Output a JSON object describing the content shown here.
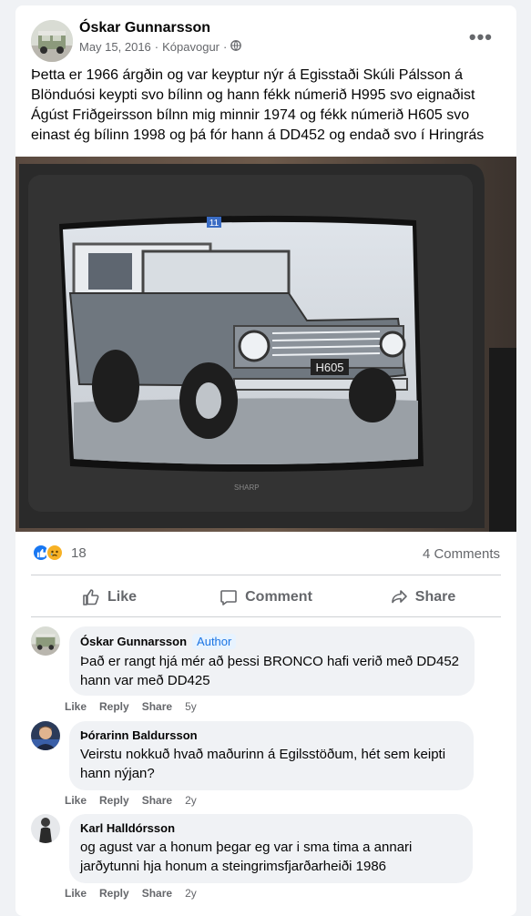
{
  "post": {
    "author": "Óskar Gunnarsson",
    "date": "May 15, 2016",
    "sep": "·",
    "location": "Kópavogur",
    "sep2": "·",
    "audience_icon": "globe-icon",
    "more_icon": "more-options-icon",
    "more_label": "•••",
    "text": "Þetta er 1966 árgðin og var keyptur nýr á Egisstaði Skúli Pálsson á Blönduósi keypti svo bílinn og hann fékk númerið H995 svo eignaðist Ágúst Friðgeirsson bílnn mig minnir 1974 og fékk númerið H605 svo einast ég bílinn 1998 og þá fór hann á DD452 og endað svo í Hringrás",
    "photo": {
      "plate": "H605",
      "channel_badge": "11",
      "tv_brand": "SHARP"
    }
  },
  "reactions": {
    "count": "18",
    "icons": [
      "like-icon",
      "sad-icon"
    ],
    "comments_label": "4 Comments"
  },
  "actions": {
    "like": "Like",
    "comment": "Comment",
    "share": "Share"
  },
  "comments": [
    {
      "name": "Óskar Gunnarsson",
      "badge": "Author",
      "text": "Það er rangt hjá mér að þessi BRONCO hafi verið með DD452 hann var með DD425",
      "like": "Like",
      "reply": "Reply",
      "share": "Share",
      "time": "5y"
    },
    {
      "name": "Þórarinn Baldursson",
      "text": "Veirstu nokkuð hvað maðurinn á Egilsstöðum, hét sem keipti hann nýjan?",
      "like": "Like",
      "reply": "Reply",
      "share": "Share",
      "time": "2y"
    },
    {
      "name": "Karl Halldórsson",
      "text": "og agust var a honum þegar eg var i sma tima a annari jarðytunni hja honum a steingrimsfjarðarheiði 1986",
      "like": "Like",
      "reply": "Reply",
      "share": "Share",
      "time": "2y"
    }
  ],
  "colors": {
    "background": "#f0f2f5",
    "card": "#ffffff",
    "secondary_text": "#65676b",
    "like_blue": "#1877f2",
    "sad_yellow": "#f7b125",
    "author_badge": "#1b74e4"
  }
}
